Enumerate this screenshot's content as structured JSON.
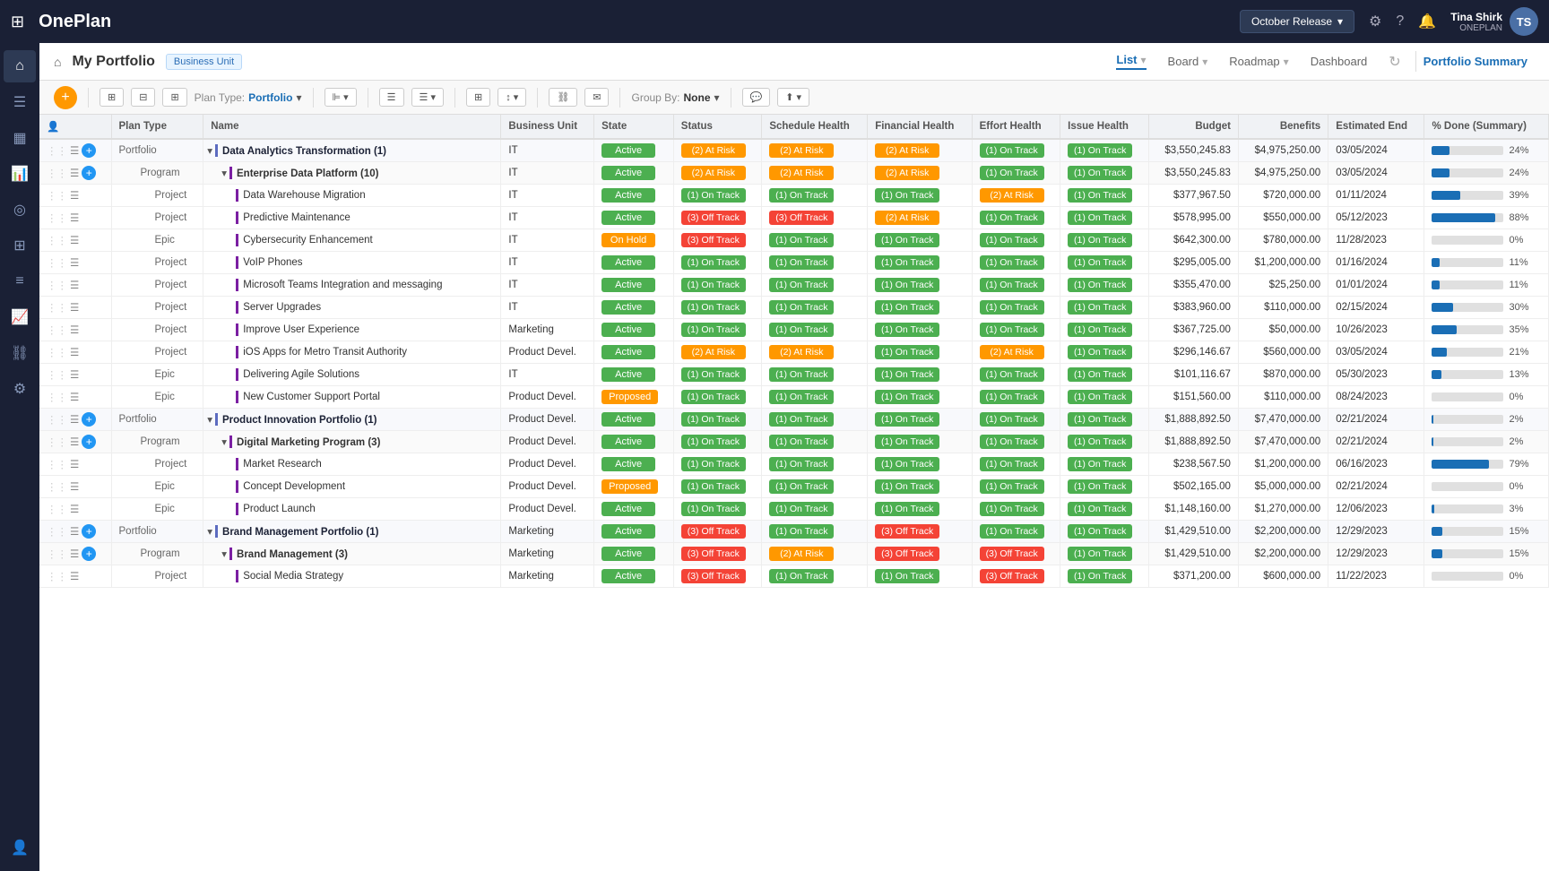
{
  "app": {
    "name": "OnePlan",
    "release": "October Release",
    "user": {
      "name": "Tina Shirk",
      "org": "ONEPLAN",
      "initials": "TS"
    }
  },
  "header": {
    "title": "My Portfolio",
    "breadcrumb": "Business Unit",
    "views": [
      "List",
      "Board",
      "Roadmap",
      "Dashboard"
    ],
    "active_view": "List",
    "portfolio_summary": "Portfolio Summary"
  },
  "toolbar": {
    "plan_type_label": "Plan Type:",
    "plan_type_value": "Portfolio",
    "group_by_label": "Group By:",
    "group_by_value": "None"
  },
  "columns": [
    "",
    "Plan Type",
    "Name",
    "Business Unit",
    "State",
    "Status",
    "Schedule Health",
    "Financial Health",
    "Effort Health",
    "Issue Health",
    "Budget",
    "Benefits",
    "Estimated End",
    "% Done (Summary)"
  ],
  "rows": [
    {
      "id": 1,
      "level": 1,
      "type": "Portfolio",
      "expand": true,
      "addChild": true,
      "name": "Data Analytics Transformation (1)",
      "business_unit": "IT",
      "state": "Active",
      "state_type": "active",
      "status": "(2) At Risk",
      "status_type": "atrisk",
      "schedule": "(2) At Risk",
      "schedule_type": "atrisk",
      "financial": "(2) At Risk",
      "financial_type": "atrisk",
      "effort": "(1) On Track",
      "effort_type": "ontrack",
      "issue": "(1) On Track",
      "issue_type": "ontrack",
      "budget": "$3,550,245.83",
      "benefits": "$4,975,250.00",
      "est_end": "03/05/2024",
      "pct_done": 24,
      "progress_color": "blue"
    },
    {
      "id": 2,
      "level": 2,
      "type": "Program",
      "expand": true,
      "addChild": true,
      "name": "Enterprise Data Platform (10)",
      "business_unit": "IT",
      "state": "Active",
      "state_type": "active",
      "status": "(2) At Risk",
      "status_type": "atrisk",
      "schedule": "(2) At Risk",
      "schedule_type": "atrisk",
      "financial": "(2) At Risk",
      "financial_type": "atrisk",
      "effort": "(1) On Track",
      "effort_type": "ontrack",
      "issue": "(1) On Track",
      "issue_type": "ontrack",
      "budget": "$3,550,245.83",
      "benefits": "$4,975,250.00",
      "est_end": "03/05/2024",
      "pct_done": 24,
      "progress_color": "blue"
    },
    {
      "id": 3,
      "level": 3,
      "type": "Project",
      "name": "Data Warehouse Migration",
      "business_unit": "IT",
      "state": "Active",
      "state_type": "active",
      "status": "(1) On Track",
      "status_type": "ontrack",
      "schedule": "(1) On Track",
      "schedule_type": "ontrack",
      "financial": "(1) On Track",
      "financial_type": "ontrack",
      "effort": "(2) At Risk",
      "effort_type": "atrisk",
      "issue": "(1) On Track",
      "issue_type": "ontrack",
      "budget": "$377,967.50",
      "benefits": "$720,000.00",
      "est_end": "01/11/2024",
      "pct_done": 39,
      "progress_color": "blue"
    },
    {
      "id": 4,
      "level": 3,
      "type": "Project",
      "name": "Predictive Maintenance",
      "business_unit": "IT",
      "state": "Active",
      "state_type": "active",
      "status": "(3) Off Track",
      "status_type": "offtrack",
      "schedule": "(3) Off Track",
      "schedule_type": "offtrack",
      "financial": "(2) At Risk",
      "financial_type": "atrisk",
      "effort": "(1) On Track",
      "effort_type": "ontrack",
      "issue": "(1) On Track",
      "issue_type": "ontrack",
      "budget": "$578,995.00",
      "benefits": "$550,000.00",
      "est_end": "05/12/2023",
      "pct_done": 88,
      "progress_color": "blue"
    },
    {
      "id": 5,
      "level": 3,
      "type": "Epic",
      "name": "Cybersecurity Enhancement",
      "business_unit": "IT",
      "state": "On Hold",
      "state_type": "onhold",
      "status": "(3) Off Track",
      "status_type": "offtrack",
      "schedule": "(1) On Track",
      "schedule_type": "ontrack",
      "financial": "(1) On Track",
      "financial_type": "ontrack",
      "effort": "(1) On Track",
      "effort_type": "ontrack",
      "issue": "(1) On Track",
      "issue_type": "ontrack",
      "budget": "$642,300.00",
      "benefits": "$780,000.00",
      "est_end": "11/28/2023",
      "pct_done": 0,
      "progress_color": "blue"
    },
    {
      "id": 6,
      "level": 3,
      "type": "Project",
      "name": "VoIP Phones",
      "business_unit": "IT",
      "state": "Active",
      "state_type": "active",
      "status": "(1) On Track",
      "status_type": "ontrack",
      "schedule": "(1) On Track",
      "schedule_type": "ontrack",
      "financial": "(1) On Track",
      "financial_type": "ontrack",
      "effort": "(1) On Track",
      "effort_type": "ontrack",
      "issue": "(1) On Track",
      "issue_type": "ontrack",
      "budget": "$295,005.00",
      "benefits": "$1,200,000.00",
      "est_end": "01/16/2024",
      "pct_done": 11,
      "progress_color": "blue"
    },
    {
      "id": 7,
      "level": 3,
      "type": "Project",
      "name": "Microsoft Teams Integration and messaging",
      "business_unit": "IT",
      "state": "Active",
      "state_type": "active",
      "status": "(1) On Track",
      "status_type": "ontrack",
      "schedule": "(1) On Track",
      "schedule_type": "ontrack",
      "financial": "(1) On Track",
      "financial_type": "ontrack",
      "effort": "(1) On Track",
      "effort_type": "ontrack",
      "issue": "(1) On Track",
      "issue_type": "ontrack",
      "budget": "$355,470.00",
      "benefits": "$25,250.00",
      "est_end": "01/01/2024",
      "pct_done": 11,
      "progress_color": "blue"
    },
    {
      "id": 8,
      "level": 3,
      "type": "Project",
      "name": "Server Upgrades",
      "business_unit": "IT",
      "state": "Active",
      "state_type": "active",
      "status": "(1) On Track",
      "status_type": "ontrack",
      "schedule": "(1) On Track",
      "schedule_type": "ontrack",
      "financial": "(1) On Track",
      "financial_type": "ontrack",
      "effort": "(1) On Track",
      "effort_type": "ontrack",
      "issue": "(1) On Track",
      "issue_type": "ontrack",
      "budget": "$383,960.00",
      "benefits": "$110,000.00",
      "est_end": "02/15/2024",
      "pct_done": 30,
      "progress_color": "blue"
    },
    {
      "id": 9,
      "level": 3,
      "type": "Project",
      "name": "Improve User Experience",
      "business_unit": "Marketing",
      "state": "Active",
      "state_type": "active",
      "status": "(1) On Track",
      "status_type": "ontrack",
      "schedule": "(1) On Track",
      "schedule_type": "ontrack",
      "financial": "(1) On Track",
      "financial_type": "ontrack",
      "effort": "(1) On Track",
      "effort_type": "ontrack",
      "issue": "(1) On Track",
      "issue_type": "ontrack",
      "budget": "$367,725.00",
      "benefits": "$50,000.00",
      "est_end": "10/26/2023",
      "pct_done": 35,
      "progress_color": "blue"
    },
    {
      "id": 10,
      "level": 3,
      "type": "Project",
      "name": "iOS Apps for Metro Transit Authority",
      "business_unit": "Product Devel.",
      "state": "Active",
      "state_type": "active",
      "status": "(2) At Risk",
      "status_type": "atrisk",
      "schedule": "(2) At Risk",
      "schedule_type": "atrisk",
      "financial": "(1) On Track",
      "financial_type": "ontrack",
      "effort": "(2) At Risk",
      "effort_type": "atrisk",
      "issue": "(1) On Track",
      "issue_type": "ontrack",
      "budget": "$296,146.67",
      "benefits": "$560,000.00",
      "est_end": "03/05/2024",
      "pct_done": 21,
      "progress_color": "blue"
    },
    {
      "id": 11,
      "level": 3,
      "type": "Epic",
      "name": "Delivering Agile Solutions",
      "business_unit": "IT",
      "state": "Active",
      "state_type": "active",
      "status": "(1) On Track",
      "status_type": "ontrack",
      "schedule": "(1) On Track",
      "schedule_type": "ontrack",
      "financial": "(1) On Track",
      "financial_type": "ontrack",
      "effort": "(1) On Track",
      "effort_type": "ontrack",
      "issue": "(1) On Track",
      "issue_type": "ontrack",
      "budget": "$101,116.67",
      "benefits": "$870,000.00",
      "est_end": "05/30/2023",
      "pct_done": 13,
      "progress_color": "blue"
    },
    {
      "id": 12,
      "level": 3,
      "type": "Epic",
      "name": "New Customer Support Portal",
      "business_unit": "Product Devel.",
      "state": "Proposed",
      "state_type": "proposed",
      "status": "(1) On Track",
      "status_type": "ontrack",
      "schedule": "(1) On Track",
      "schedule_type": "ontrack",
      "financial": "(1) On Track",
      "financial_type": "ontrack",
      "effort": "(1) On Track",
      "effort_type": "ontrack",
      "issue": "(1) On Track",
      "issue_type": "ontrack",
      "budget": "$151,560.00",
      "benefits": "$110,000.00",
      "est_end": "08/24/2023",
      "pct_done": 0,
      "progress_color": "blue"
    },
    {
      "id": 13,
      "level": 1,
      "type": "Portfolio",
      "expand": true,
      "addChild": true,
      "name": "Product Innovation Portfolio (1)",
      "business_unit": "Product Devel.",
      "state": "Active",
      "state_type": "active",
      "status": "(1) On Track",
      "status_type": "ontrack",
      "schedule": "(1) On Track",
      "schedule_type": "ontrack",
      "financial": "(1) On Track",
      "financial_type": "ontrack",
      "effort": "(1) On Track",
      "effort_type": "ontrack",
      "issue": "(1) On Track",
      "issue_type": "ontrack",
      "budget": "$1,888,892.50",
      "benefits": "$7,470,000.00",
      "est_end": "02/21/2024",
      "pct_done": 2,
      "progress_color": "blue"
    },
    {
      "id": 14,
      "level": 2,
      "type": "Program",
      "expand": true,
      "addChild": true,
      "name": "Digital Marketing Program (3)",
      "business_unit": "Product Devel.",
      "state": "Active",
      "state_type": "active",
      "status": "(1) On Track",
      "status_type": "ontrack",
      "schedule": "(1) On Track",
      "schedule_type": "ontrack",
      "financial": "(1) On Track",
      "financial_type": "ontrack",
      "effort": "(1) On Track",
      "effort_type": "ontrack",
      "issue": "(1) On Track",
      "issue_type": "ontrack",
      "budget": "$1,888,892.50",
      "benefits": "$7,470,000.00",
      "est_end": "02/21/2024",
      "pct_done": 2,
      "progress_color": "blue"
    },
    {
      "id": 15,
      "level": 3,
      "type": "Project",
      "name": "Market Research",
      "business_unit": "Product Devel.",
      "state": "Active",
      "state_type": "active",
      "status": "(1) On Track",
      "status_type": "ontrack",
      "schedule": "(1) On Track",
      "schedule_type": "ontrack",
      "financial": "(1) On Track",
      "financial_type": "ontrack",
      "effort": "(1) On Track",
      "effort_type": "ontrack",
      "issue": "(1) On Track",
      "issue_type": "ontrack",
      "budget": "$238,567.50",
      "benefits": "$1,200,000.00",
      "est_end": "06/16/2023",
      "pct_done": 79,
      "progress_color": "blue"
    },
    {
      "id": 16,
      "level": 3,
      "type": "Epic",
      "name": "Concept Development",
      "business_unit": "Product Devel.",
      "state": "Proposed",
      "state_type": "proposed",
      "status": "(1) On Track",
      "status_type": "ontrack",
      "schedule": "(1) On Track",
      "schedule_type": "ontrack",
      "financial": "(1) On Track",
      "financial_type": "ontrack",
      "effort": "(1) On Track",
      "effort_type": "ontrack",
      "issue": "(1) On Track",
      "issue_type": "ontrack",
      "budget": "$502,165.00",
      "benefits": "$5,000,000.00",
      "est_end": "02/21/2024",
      "pct_done": 0,
      "progress_color": "blue"
    },
    {
      "id": 17,
      "level": 3,
      "type": "Epic",
      "name": "Product Launch",
      "business_unit": "Product Devel.",
      "state": "Active",
      "state_type": "active",
      "status": "(1) On Track",
      "status_type": "ontrack",
      "schedule": "(1) On Track",
      "schedule_type": "ontrack",
      "financial": "(1) On Track",
      "financial_type": "ontrack",
      "effort": "(1) On Track",
      "effort_type": "ontrack",
      "issue": "(1) On Track",
      "issue_type": "ontrack",
      "budget": "$1,148,160.00",
      "benefits": "$1,270,000.00",
      "est_end": "12/06/2023",
      "pct_done": 3,
      "progress_color": "blue"
    },
    {
      "id": 18,
      "level": 1,
      "type": "Portfolio",
      "expand": true,
      "addChild": true,
      "name": "Brand Management Portfolio (1)",
      "business_unit": "Marketing",
      "state": "Active",
      "state_type": "active",
      "status": "(3) Off Track",
      "status_type": "offtrack",
      "schedule": "(1) On Track",
      "schedule_type": "ontrack",
      "financial": "(3) Off Track",
      "financial_type": "offtrack",
      "effort": "(1) On Track",
      "effort_type": "ontrack",
      "issue": "(1) On Track",
      "issue_type": "ontrack",
      "budget": "$1,429,510.00",
      "benefits": "$2,200,000.00",
      "est_end": "12/29/2023",
      "pct_done": 15,
      "progress_color": "blue"
    },
    {
      "id": 19,
      "level": 2,
      "type": "Program",
      "expand": true,
      "addChild": true,
      "name": "Brand Management (3)",
      "business_unit": "Marketing",
      "state": "Active",
      "state_type": "active",
      "status": "(3) Off Track",
      "status_type": "offtrack",
      "schedule": "(2) At Risk",
      "schedule_type": "atrisk",
      "financial": "(3) Off Track",
      "financial_type": "offtrack",
      "effort": "(3) Off Track",
      "effort_type": "offtrack",
      "issue": "(1) On Track",
      "issue_type": "ontrack",
      "budget": "$1,429,510.00",
      "benefits": "$2,200,000.00",
      "est_end": "12/29/2023",
      "pct_done": 15,
      "progress_color": "blue"
    },
    {
      "id": 20,
      "level": 3,
      "type": "Project",
      "name": "Social Media Strategy",
      "business_unit": "Marketing",
      "state": "Active",
      "state_type": "active",
      "status": "(3) Off Track",
      "status_type": "offtrack",
      "schedule": "(1) On Track",
      "schedule_type": "ontrack",
      "financial": "(1) On Track",
      "financial_type": "ontrack",
      "effort": "(3) Off Track",
      "effort_type": "offtrack",
      "issue": "(1) On Track",
      "issue_type": "ontrack",
      "budget": "$371,200.00",
      "benefits": "$600,000.00",
      "est_end": "11/22/2023",
      "pct_done": 0,
      "progress_color": "blue"
    }
  ]
}
